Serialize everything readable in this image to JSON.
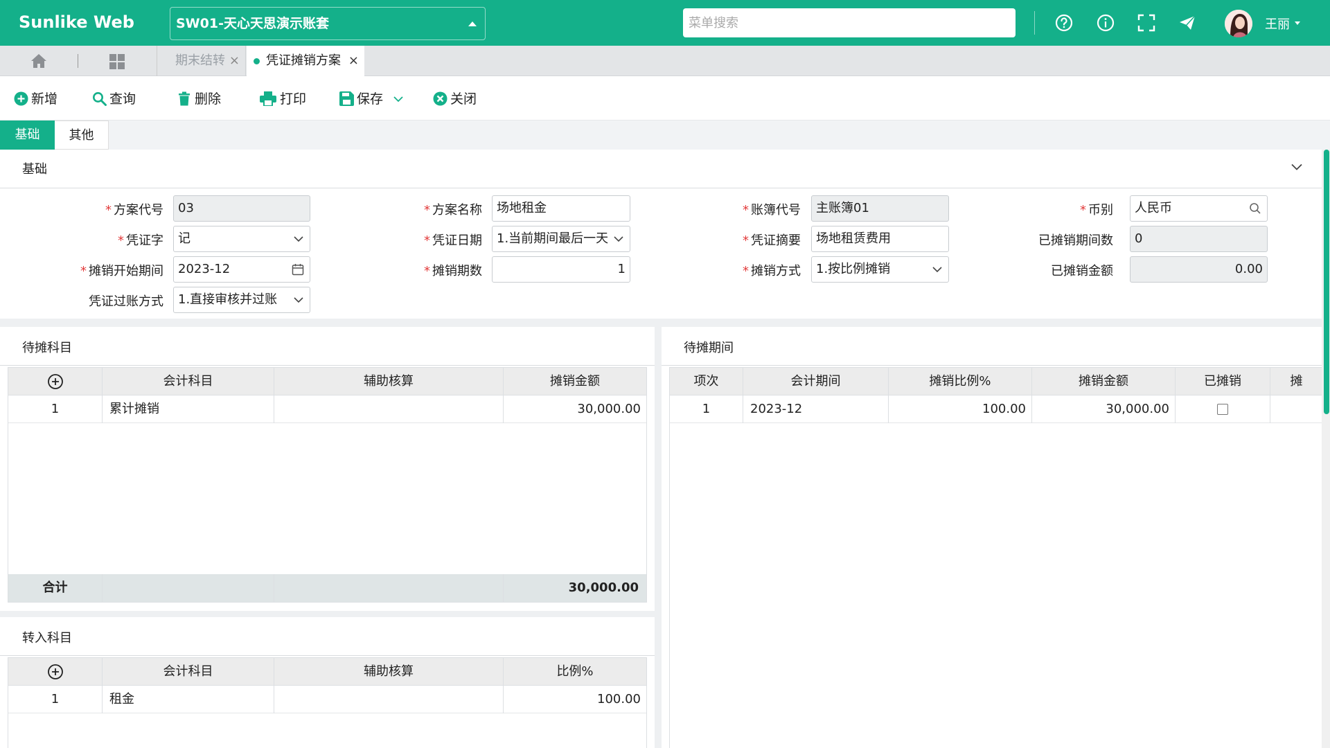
{
  "topbar": {
    "logo": "Sunlike Web",
    "account": "SW01-天心天思演示账套",
    "search_placeholder": "菜单搜索",
    "user_name": "王丽",
    "icons": [
      "help-circle-icon",
      "info-circle-icon",
      "fullscreen-icon",
      "paper-plane-icon"
    ]
  },
  "tabs": [
    {
      "label": "期末结转",
      "active": false
    },
    {
      "label": "凭证摊销方案",
      "active": true
    }
  ],
  "toolbar": {
    "add": "新增",
    "query": "查询",
    "delete": "删除",
    "print": "打印",
    "save": "保存",
    "close": "关闭"
  },
  "form_tabs": [
    "基础",
    "其他"
  ],
  "base": {
    "section_title": "基础",
    "plan_code_label": "方案代号",
    "plan_code": "03",
    "plan_name_label": "方案名称",
    "plan_name": "场地租金",
    "book_code_label": "账簿代号",
    "book_code": "主账簿01",
    "currency_label": "币别",
    "currency": "人民币",
    "voucher_word_label": "凭证字",
    "voucher_word": "记",
    "voucher_date_label": "凭证日期",
    "voucher_date": "1.当前期间最后一天",
    "voucher_summary_label": "凭证摘要",
    "voucher_summary": "场地租赁费用",
    "amortized_periods_label": "已摊销期间数",
    "amortized_periods": "0",
    "start_period_label": "摊销开始期间",
    "start_period": "2023-12",
    "period_count_label": "摊销期数",
    "period_count": "1",
    "method_label": "摊销方式",
    "method": "1.按比例摊销",
    "amortized_amount_label": "已摊销金额",
    "amortized_amount": "0.00",
    "posting_label": "凭证过账方式",
    "posting": "1.直接审核并过账"
  },
  "pending_subjects": {
    "title": "待摊科目",
    "headers": [
      "会计科目",
      "辅助核算",
      "摊销金额"
    ],
    "rows": [
      {
        "no": "1",
        "subject": "累计摊销",
        "aux": "",
        "amount": "30,000.00"
      }
    ],
    "total_label": "合计",
    "total_amount": "30,000.00"
  },
  "pending_periods": {
    "title": "待摊期间",
    "headers": [
      "项次",
      "会计期间",
      "摊销比例%",
      "摊销金额",
      "已摊销",
      "摊"
    ],
    "rows": [
      {
        "no": "1",
        "period": "2023-12",
        "ratio": "100.00",
        "amount": "30,000.00",
        "done": false
      }
    ]
  },
  "transfer_subjects": {
    "title": "转入科目",
    "headers": [
      "会计科目",
      "辅助核算",
      "比例%"
    ],
    "rows": [
      {
        "no": "1",
        "subject": "租金",
        "aux": "",
        "ratio": "100.00"
      }
    ]
  },
  "colors": {
    "accent": "#14b08a",
    "required": "#e23b3b"
  }
}
